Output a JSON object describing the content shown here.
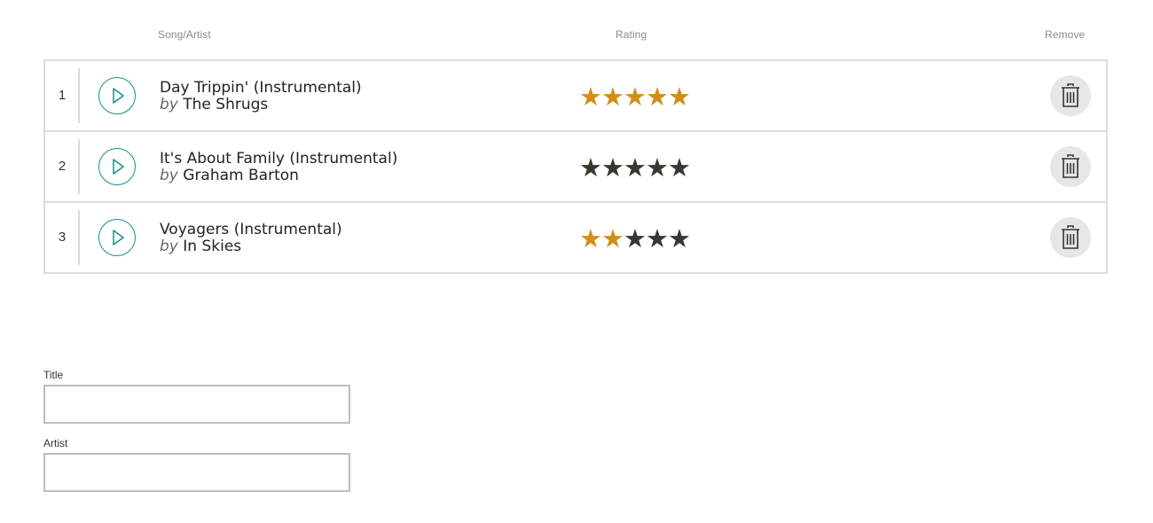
{
  "headers": {
    "song_artist": "Song/Artist",
    "rating": "Rating",
    "remove": "Remove"
  },
  "songs": [
    {
      "number": "1",
      "title": "Day Trippin' (Instrumental)",
      "by": "by",
      "artist": "The Shrugs",
      "rating": 5,
      "max_rating": 5
    },
    {
      "number": "2",
      "title": "It's About Family (Instrumental)",
      "by": "by",
      "artist": "Graham Barton",
      "rating": 0,
      "max_rating": 5
    },
    {
      "number": "3",
      "title": "Voyagers (Instrumental)",
      "by": "by",
      "artist": "In Skies",
      "rating": 2,
      "max_rating": 5
    }
  ],
  "form": {
    "title_label": "Title",
    "title_value": "",
    "artist_label": "Artist",
    "artist_value": ""
  },
  "icons": {
    "play": "play-icon",
    "remove": "trash-icon",
    "star": "star-icon"
  },
  "colors": {
    "star_on": "#d18e16",
    "star_off": "#3a3632",
    "accent": "#1a8f8a",
    "border": "#dcdcdc"
  }
}
